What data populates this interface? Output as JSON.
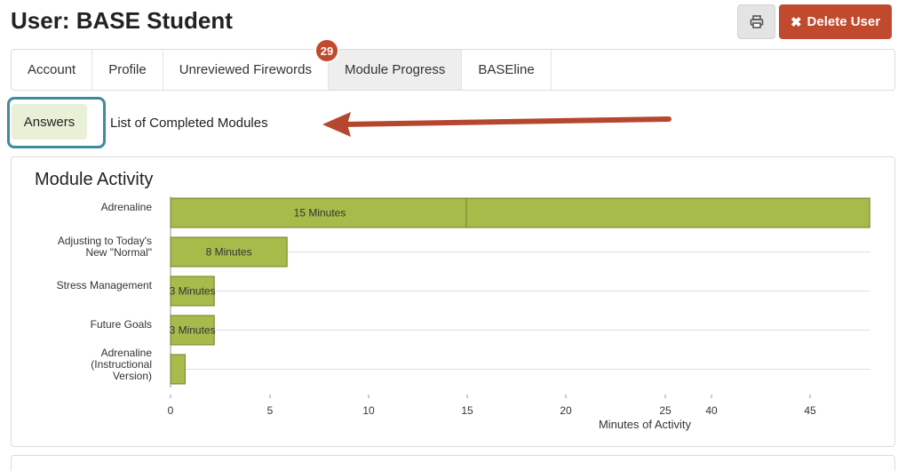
{
  "page": {
    "title": "User: BASE Student"
  },
  "header": {
    "print_icon": "printer-icon",
    "delete_icon": "x-icon",
    "delete_label": "Delete User"
  },
  "tabs": [
    {
      "label": "Account"
    },
    {
      "label": "Profile"
    },
    {
      "label": "Unreviewed Firewords",
      "badge": "29"
    },
    {
      "label": "Module Progress",
      "active": true
    },
    {
      "label": "BASEline"
    }
  ],
  "subnav": {
    "answers_label": "Answers",
    "list_label": "List of Completed Modules"
  },
  "panel": {
    "title": "Module Activity"
  },
  "colors": {
    "bar": "#a7bb4b",
    "bar_border": "#6f7f2b",
    "danger": "#c1492d",
    "highlight": "#3d8c9e",
    "arrow": "#b6472f"
  },
  "chart_data": {
    "type": "bar",
    "orientation": "horizontal",
    "categories": [
      "Adrenaline",
      "Adjusting to Today's New \"Normal\"",
      "Stress Management",
      "Future Goals",
      "Adrenaline (Instructional Version)"
    ],
    "category_lines": [
      [
        "Adrenaline"
      ],
      [
        "Adjusting to Today's",
        "New \"Normal\""
      ],
      [
        "Stress Management"
      ],
      [
        "Future Goals"
      ],
      [
        "Adrenaline",
        "(Instructional",
        "Version)"
      ]
    ],
    "values": [
      48,
      8,
      3,
      3,
      1
    ],
    "data_labels": [
      "15 Minutes",
      "8 Minutes",
      "3 Minutes",
      "3 Minutes",
      ""
    ],
    "x_ticks": [
      0,
      5,
      10,
      15,
      20,
      25,
      40,
      45
    ],
    "xlabel": "Minutes of Activity",
    "ylabel": "",
    "grid": true
  }
}
